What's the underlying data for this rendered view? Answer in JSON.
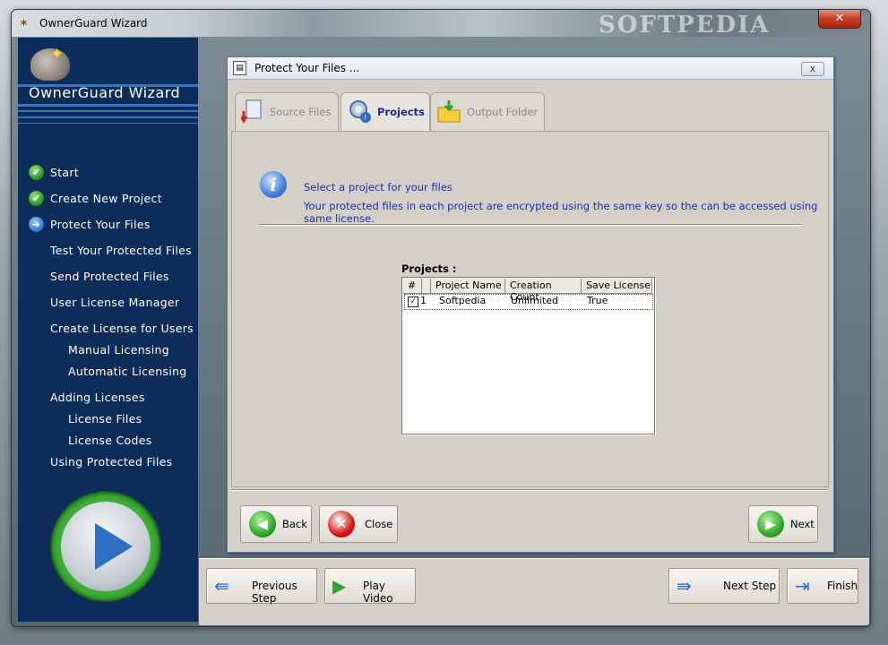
{
  "window": {
    "title": "OwnerGuard Wizard",
    "close_label": "✕",
    "watermark": "SOFTPEDIA"
  },
  "sidebar": {
    "app_name": "OwnerGuard Wizard",
    "steps": [
      {
        "label": "Start",
        "state": "done",
        "indent": 0
      },
      {
        "label": "Create New Project",
        "state": "done",
        "indent": 0
      },
      {
        "label": "Protect Your Files",
        "state": "current",
        "indent": 0
      },
      {
        "label": "Test Your Protected Files",
        "state": "pending",
        "indent": 0
      },
      {
        "label": "Send Protected Files",
        "state": "pending",
        "indent": 0
      },
      {
        "label": "User License Manager",
        "state": "pending",
        "indent": 0
      },
      {
        "label": "Create License for Users",
        "state": "pending",
        "indent": 0
      },
      {
        "label": "Manual Licensing",
        "state": "pending",
        "indent": 1
      },
      {
        "label": "Automatic Licensing",
        "state": "pending",
        "indent": 1
      },
      {
        "label": "Adding Licenses",
        "state": "pending",
        "indent": 0
      },
      {
        "label": "License Files",
        "state": "pending",
        "indent": 1
      },
      {
        "label": "License Codes",
        "state": "pending",
        "indent": 1
      },
      {
        "label": "Using Protected Files",
        "state": "pending",
        "indent": 0
      }
    ],
    "play_icon": "big-play-icon"
  },
  "dialog": {
    "title": "Protect Your Files ...",
    "close_label": "x",
    "tabs": [
      {
        "label": "Source Files",
        "icon": "source-files-icon",
        "active": false
      },
      {
        "label": "Projects",
        "icon": "projects-icon",
        "active": true
      },
      {
        "label": "Output Folder",
        "icon": "output-folder-icon",
        "active": false
      }
    ],
    "message_line1": "Select a project for your files",
    "message_line2": "Your protected files in each project are encrypted using the same key so the can be accessed using same license.",
    "projects_label": "Projects :",
    "columns": [
      "#",
      "Project Name",
      "Creation Count",
      "Save License"
    ],
    "rows": [
      {
        "num": "1",
        "checked": true,
        "name": "Softpedia",
        "count": "Unlimited",
        "save_license": "True"
      }
    ],
    "buttons": {
      "back": "Back",
      "close": "Close",
      "next": "Next"
    }
  },
  "nav": {
    "previous": "Previous Step",
    "play_video": "Play Video",
    "next_step": "Next Step",
    "finish": "Finish"
  }
}
